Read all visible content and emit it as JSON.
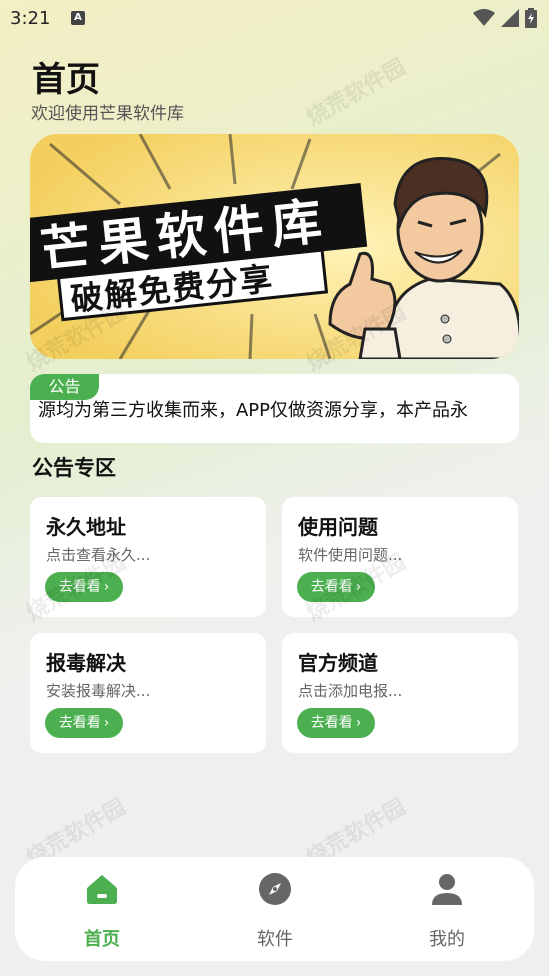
{
  "status_bar": {
    "time": "3:21",
    "keyboard_indicator": "A"
  },
  "header": {
    "title": "首页",
    "subtitle": "欢迎使用芒果软件库"
  },
  "banner": {
    "headline": "芒果软件库",
    "subline": "破解免费分享"
  },
  "notice": {
    "tag": "公告",
    "text": "源均为第三方收集而来，APP仅做资源分享，本产品永"
  },
  "section": {
    "title": "公告专区"
  },
  "cards": [
    {
      "title": "永久地址",
      "desc": "点击查看永久...",
      "button": "去看看"
    },
    {
      "title": "使用问题",
      "desc": "软件使用问题...",
      "button": "去看看"
    },
    {
      "title": "报毒解决",
      "desc": "安装报毒解决...",
      "button": "去看看"
    },
    {
      "title": "官方频道",
      "desc": "点击添加电报...",
      "button": "去看看"
    }
  ],
  "watermark": "烧荒软件园",
  "nav": [
    {
      "label": "首页",
      "icon": "home-icon",
      "active": true
    },
    {
      "label": "软件",
      "icon": "compass-icon",
      "active": false
    },
    {
      "label": "我的",
      "icon": "user-icon",
      "active": false
    }
  ],
  "colors": {
    "accent": "#4caf50",
    "banner_bg": "#f6d873"
  }
}
